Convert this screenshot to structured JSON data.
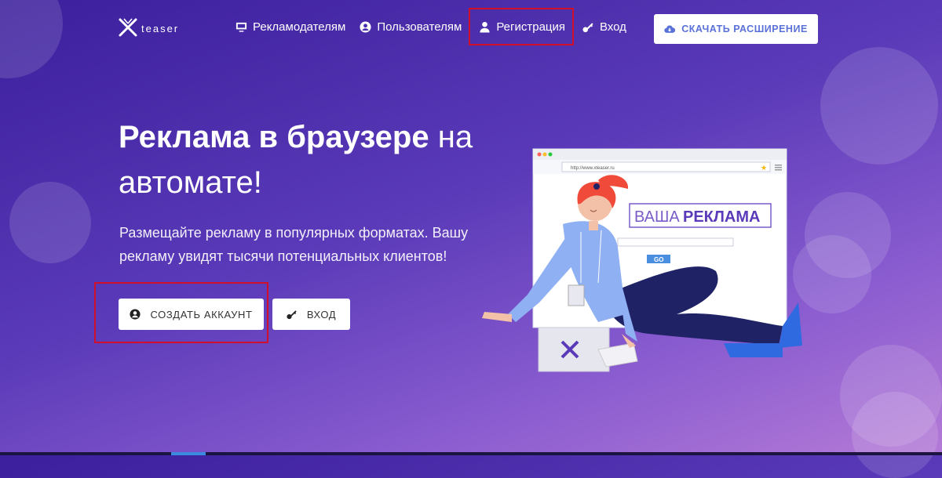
{
  "header": {
    "logo_text": "teaser",
    "nav": [
      {
        "label": "Рекламодателям",
        "icon": "monitor-icon"
      },
      {
        "label": "Пользователям",
        "icon": "user-circle-icon"
      },
      {
        "label": "Регистрация",
        "icon": "user-icon"
      },
      {
        "label": "Вход",
        "icon": "key-icon"
      }
    ],
    "download_label": "СКАЧАТЬ РАСШИРЕНИЕ"
  },
  "hero": {
    "title_bold": "Реклама в браузере",
    "title_rest": " на автомате!",
    "subtitle": "Размещайте рекламу в популярных форматах. Вашу рекламу увидят тысячи потенциальных клиентов!",
    "create_label": "СОЗДАТЬ АККАУНТ",
    "login_label": "ВХОД"
  },
  "illustration": {
    "url": "http://www.xteaser.ru",
    "ad_word1": "ВАША",
    "ad_word2": "РЕКЛАМА",
    "go_label": "GO"
  },
  "colors": {
    "accent_blue": "#5a72d8",
    "highlight_red": "#d0102a",
    "bg_start": "#3b1f9c",
    "bg_end": "#b47ad6"
  }
}
